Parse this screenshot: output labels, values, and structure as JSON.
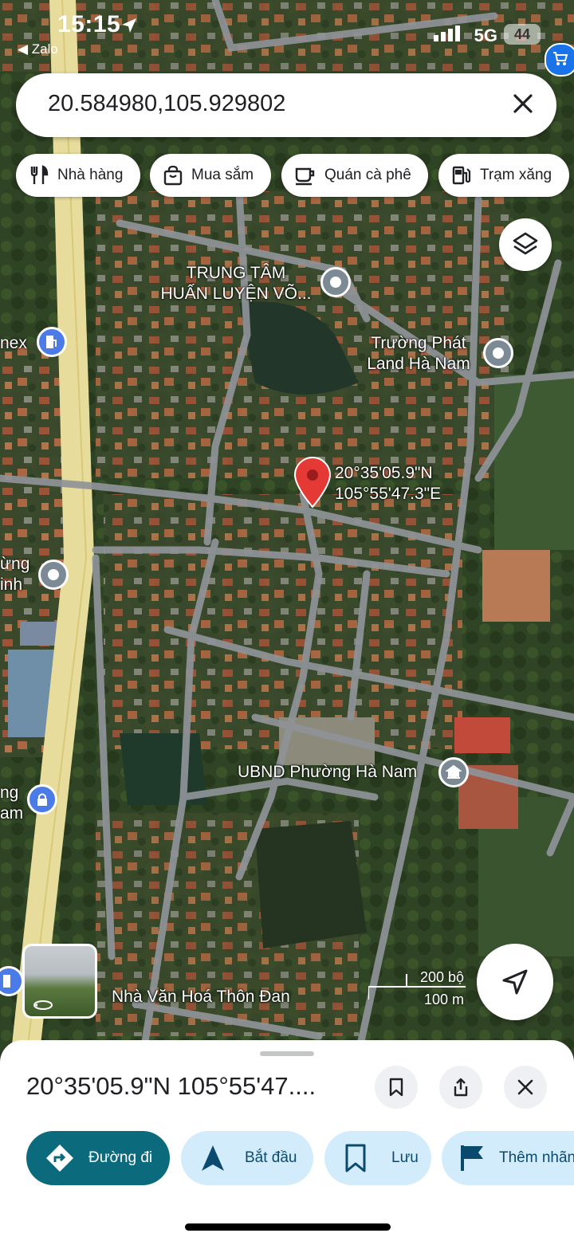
{
  "status_bar": {
    "time": "15:15",
    "back_app": "◀ Zalo",
    "network": "5G",
    "battery": "44"
  },
  "search": {
    "query": "20.584980,105.929802"
  },
  "chips": [
    {
      "label": "Nhà hàng",
      "icon": "restaurant-icon"
    },
    {
      "label": "Mua sắm",
      "icon": "shopping-bag-icon"
    },
    {
      "label": "Quán cà phê",
      "icon": "coffee-cup-icon"
    },
    {
      "label": "Trạm xăng",
      "icon": "gas-station-icon"
    }
  ],
  "map": {
    "marker_coords_line1": "20°35'05.9\"N",
    "marker_coords_line2": "105°55'47.3\"E",
    "places": {
      "training_center_1": "TRUNG TÂM",
      "training_center_2": "HUẤN LUYỆN VÕ...",
      "truong_phat_1": "Trường Phát",
      "truong_phat_2": "Land Hà Nam",
      "nex": "nex",
      "ung": "ừng",
      "inh": "inh",
      "ng": "ng",
      "am": "am",
      "ubnd": "UBND Phường Hà Nam",
      "cultural_house": "Nhà Văn Hoá Thôn Đan"
    },
    "scale_imperial": "200 bộ",
    "scale_metric": "100 m"
  },
  "sheet": {
    "title": "20°35'05.9\"N 105°55'47....",
    "actions": [
      {
        "label": "Đường đi",
        "icon": "directions-icon"
      },
      {
        "label": "Bắt đầu",
        "icon": "navigation-arrow-icon"
      },
      {
        "label": "Lưu",
        "icon": "bookmark-icon"
      },
      {
        "label": "Thêm nhãn",
        "icon": "flag-icon"
      }
    ]
  },
  "colors": {
    "primary_button": "#0b6b7d",
    "secondary_button": "#d3ecfb",
    "marker": "#e53935",
    "highway": "#e7dc9c"
  }
}
